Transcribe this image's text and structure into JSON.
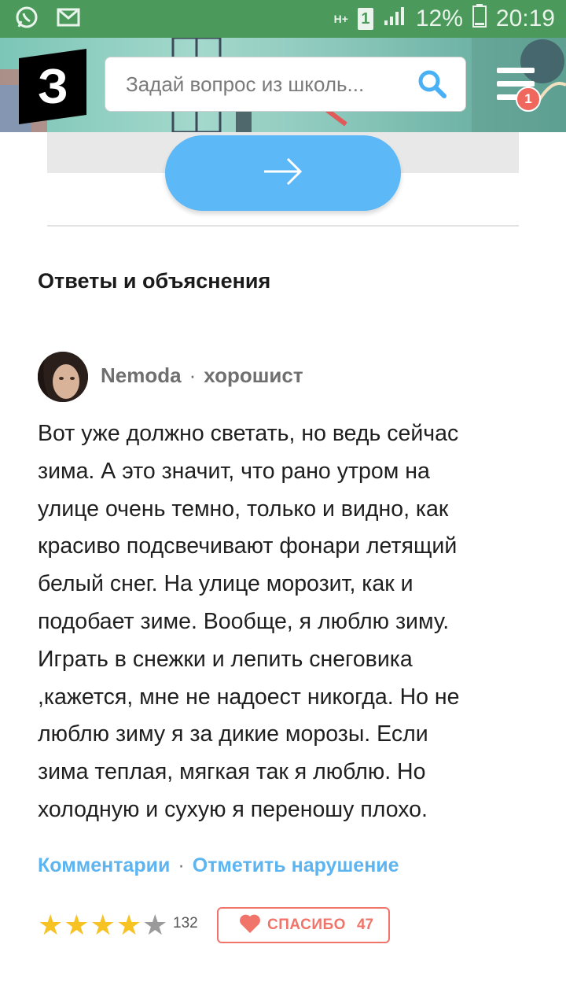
{
  "status_bar": {
    "left_icons": [
      "whatsapp-icon",
      "mail-icon"
    ],
    "network": "H+",
    "sim": "1",
    "battery": "12%",
    "time": "20:19"
  },
  "header": {
    "logo_text": "З",
    "search_placeholder": "Задай вопрос из школь...",
    "menu_badge": "1"
  },
  "answers": {
    "section_title": "Ответы и объяснения",
    "author": {
      "name": "Nemoda",
      "rank": "хорошист"
    },
    "text_lines": [
      "Вот уже должно светать, но ведь сейчас",
      "зима. А это значит, что рано утром на",
      "улице очень темно, только и видно, как",
      "красиво подсвечивают фонари летящий",
      "белый снег. На улице морозит, как и",
      "подобает зиме. Вообще, я люблю зиму.",
      "Играть в снежки и лепить снеговика",
      ",кажется, мне не надоест никогда. Но не",
      "люблю зиму я за дикие морозы. Если",
      "зима теплая, мягкая так я люблю. Но",
      "холодную и сухую я переношу плохо."
    ],
    "comments_link": "Комментарии",
    "report_link": "Отметить нарушение",
    "rating": {
      "stars_filled": 4,
      "stars_total": 5,
      "count": "132"
    },
    "thanks": {
      "label": "СПАСИБО",
      "count": "47"
    }
  },
  "colors": {
    "status_bar": "#4b9a5b",
    "accent_blue": "#5cb8f7",
    "link_blue": "#5cb4f0",
    "thanks_red": "#f0746a",
    "star_yellow": "#f7c224",
    "star_grey": "#9a9a9a"
  }
}
